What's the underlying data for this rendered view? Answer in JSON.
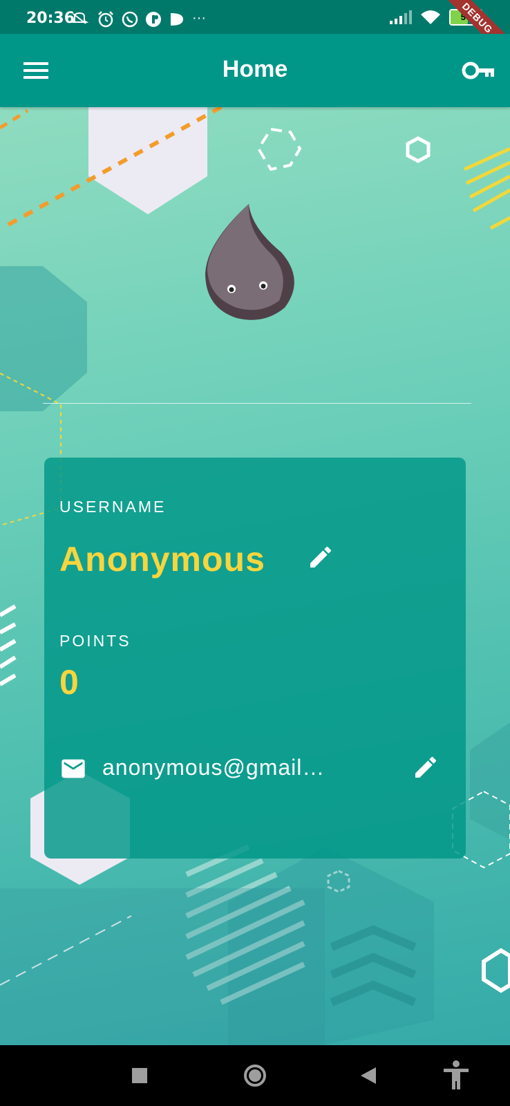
{
  "status_bar": {
    "time": "20:36",
    "battery_level": "56",
    "battery_fraction": 0.56,
    "left_icons": [
      "mute-icon",
      "alarm-icon",
      "whatsapp-icon",
      "app-icon",
      "play-icon",
      "more-dots-icon"
    ],
    "right_icons": [
      "signal-icon",
      "wifi-icon",
      "battery-icon",
      "charging-icon"
    ]
  },
  "debug_banner": "DEBUG",
  "app_bar": {
    "title": "Home",
    "menu_icon": "menu-icon",
    "action_icon": "key-icon"
  },
  "profile": {
    "username_label": "USERNAME",
    "username": "Anonymous",
    "points_label": "POINTS",
    "points": "0",
    "email": "anonymous@gmail…"
  },
  "colors": {
    "app_bar": "#009688",
    "status_bar": "#00796b",
    "accent_yellow": "#f7d53f",
    "card": "#009688"
  },
  "nav_bar": {
    "buttons": [
      "recents-square-icon",
      "home-circle-icon",
      "back-triangle-icon",
      "accessibility-icon"
    ]
  }
}
